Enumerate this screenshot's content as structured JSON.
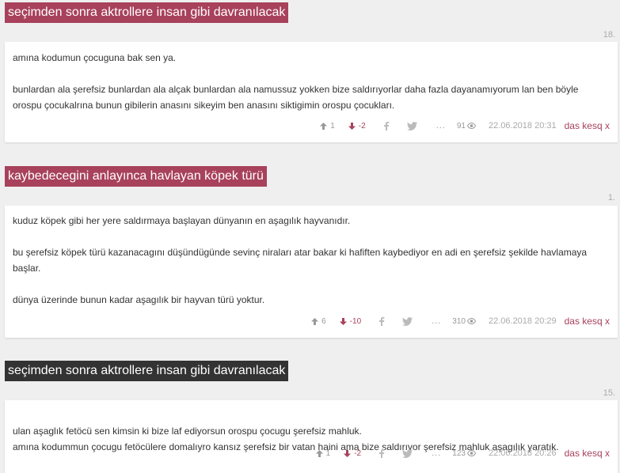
{
  "entries": [
    {
      "title": "seçimden sonra aktrollere insan gibi davranılacak",
      "index": "18.",
      "paragraphs": [
        "amına kodumun çocuguna bak sen ya.",
        "bunlardan ala şerefsiz bunlardan ala alçak bunlardan ala namussuz yokken bize saldırıyorlar daha fazla dayanamıyorum lan ben böyle orospu çocukalrına bunun gibilerin anasını sikeyim ben anasını siktigimin orospu çocukları."
      ],
      "upvotes": "1",
      "downvotes": "-2",
      "dots": "...",
      "views": "91",
      "date": "22.06.2018 20:31",
      "author": "das kesq x"
    },
    {
      "title": "kaybedecegini anlayınca havlayan köpek türü",
      "index": "1.",
      "paragraphs": [
        "kuduz köpek gibi her yere saldırmaya başlayan dünyanın en aşagılık hayvanıdır.",
        "bu şerefsiz köpek türü kazanacagını düşündügünde sevinç niraları atar bakar ki hafiften kaybediyor en adi en şerefsiz şekilde havlamaya başlar.",
        "dünya üzerinde bunun kadar aşagılık bir hayvan türü yoktur."
      ],
      "upvotes": "6",
      "downvotes": "-10",
      "dots": "...",
      "views": "310",
      "date": "22.06.2018 20:29",
      "author": "das kesq x"
    },
    {
      "title": "seçimden sonra aktrollere insan gibi davranılacak",
      "index": "15.",
      "paragraphs": [
        "ulan aşaglık fetöcü sen kimsin ki bize laf ediyorsun orospu çocugu şerefsiz mahluk.\namına kodummun çocugu fetöcülere domalıyro kansız şerefsiz bir vatan haini ama bize saldırıyor şerefsiz mahluk aşagılık yaratık."
      ],
      "upvotes": "1",
      "downvotes": "-2",
      "dots": "...",
      "views": "123",
      "date": "22.06.2018 20:26",
      "author": "das kesq x"
    }
  ],
  "colors": {
    "accent": "#a8415b",
    "title_dark": "#333333",
    "background": "#efefef"
  },
  "icons": [
    "arrow-up-icon",
    "arrow-down-icon",
    "facebook-icon",
    "twitter-icon",
    "eye-icon"
  ]
}
